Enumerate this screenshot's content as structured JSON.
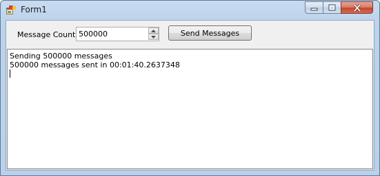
{
  "window": {
    "title": "Form1",
    "icon": "form-icon"
  },
  "caption_buttons": {
    "minimize_icon": "minimize-icon",
    "maximize_icon": "maximize-icon",
    "close_icon": "close-icon"
  },
  "form": {
    "message_count_label": "Message Count",
    "message_count_value": "500000",
    "send_button_label": "Send Messages"
  },
  "log": {
    "lines": [
      "Sending 500000 messages",
      "500000 messages sent in 00:01:40.2637348"
    ]
  }
}
